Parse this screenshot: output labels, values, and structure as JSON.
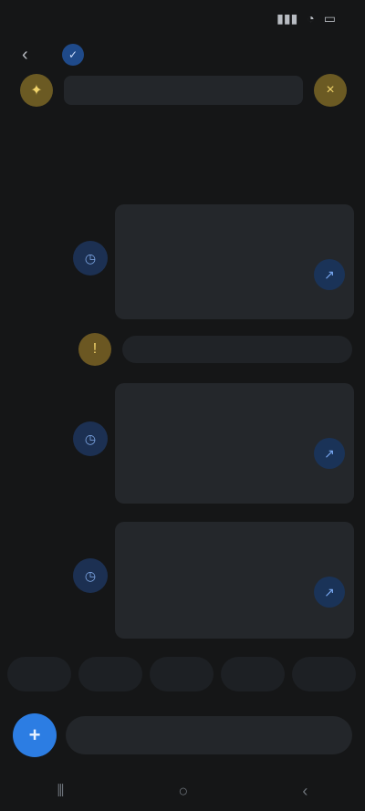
{
  "status": {
    "time": "",
    "right": ""
  },
  "header": {
    "title": "",
    "badge_icon": "verified-icon"
  },
  "pinned": {
    "text": ""
  },
  "date_divider": "",
  "messages": [
    {
      "title": "",
      "amount": "",
      "meta": "",
      "time": ""
    },
    {
      "title": "",
      "amount": "",
      "meta": "",
      "time": ""
    },
    {
      "title": "",
      "amount": "",
      "meta": "",
      "time": ""
    }
  ],
  "system_message": {
    "text": ""
  },
  "quick_actions": [
    "",
    "",
    "",
    "",
    ""
  ],
  "composer": {
    "placeholder": "",
    "right_label": ""
  },
  "colors": {
    "background": "#151617",
    "accent_blue": "#2c7de3",
    "accent_yellow": "#f1d36b",
    "accent_green": "#3c7a3a"
  }
}
